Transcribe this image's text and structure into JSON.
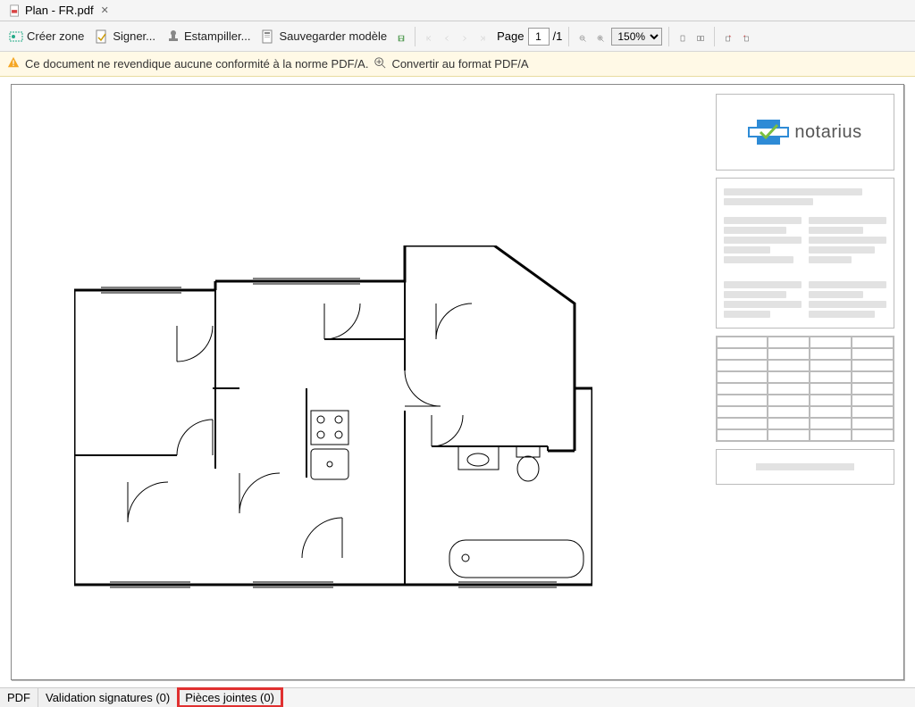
{
  "tab": {
    "title": "Plan - FR.pdf"
  },
  "toolbar": {
    "create_zone": "Créer zone",
    "sign": "Signer...",
    "stamp": "Estampiller...",
    "save_model": "Sauvegarder modèle",
    "page_label": "Page",
    "page_current": "1",
    "page_total": "/1",
    "zoom_value": "150%"
  },
  "infobar": {
    "message": "Ce document ne revendique aucune conformité à la norme PDF/A.",
    "action": "Convertir au format PDF/A"
  },
  "sidepanel": {
    "brand": "notarius"
  },
  "bottom": {
    "pdf": "PDF",
    "validation": "Validation signatures (0)",
    "attachments": "Pièces jointes (0)"
  }
}
